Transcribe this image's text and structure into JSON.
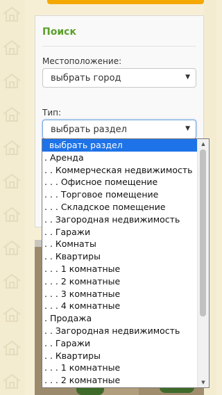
{
  "search_panel": {
    "title": "Поиск",
    "location_label": "Местоположение:",
    "location_value": "выбрать город",
    "type_label": "Тип:",
    "type_value": "выбрать раздел"
  },
  "dropdown": {
    "items": [
      "выбрать раздел",
      ". Аренда",
      ". . Коммерческая недвижимость",
      ". . . Офисное помещение",
      ". . . Торговое помещение",
      ". . . Складское помещение",
      ". . Загородная недвижимость",
      ". . Гаражи",
      ". . Комнаты",
      ". . Квартиры",
      ". . . 1 комнатные",
      ". . . 2 комнатные",
      ". . . 3 комнатные",
      ". . . 4 комнатные",
      ". Продажа",
      ". . Загородная недвижимость",
      ". . Гаражи",
      ". . Квартиры",
      ". . . 1 комнатные",
      ". . . 2 комнатные"
    ],
    "selected_index": 0
  },
  "icons": {
    "dropdown_arrow": "chevron-down-icon",
    "scroll_up": "scroll-up-icon",
    "scroll_down": "scroll-down-icon",
    "background_pattern": "house-icon"
  },
  "colors": {
    "accent_green": "#5aa02c",
    "accent_orange": "#f5a800",
    "selection_blue": "#1e73e8"
  }
}
